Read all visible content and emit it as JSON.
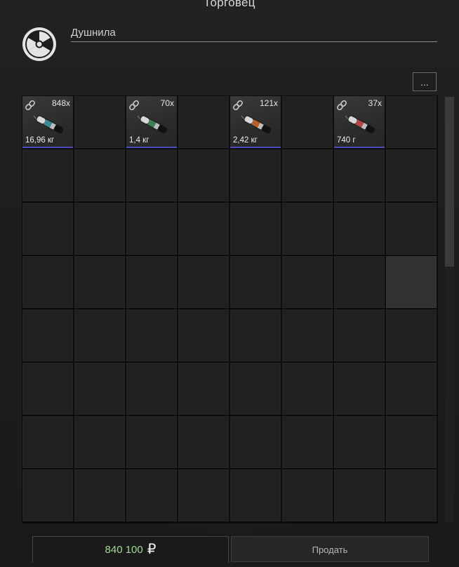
{
  "window": {
    "title": "Торговец"
  },
  "trader": {
    "icon": "radiation-icon",
    "name": "Душнила"
  },
  "toolbar": {
    "more_label": "..."
  },
  "inventory": {
    "columns": 8,
    "rows": 8,
    "items": [
      {
        "quantity": "848x",
        "weight": "16,96 кг",
        "icon": "canister-icon",
        "band_color": "#3d8a95"
      },
      {
        "quantity": "70x",
        "weight": "1,4 кг",
        "icon": "canister-icon",
        "band_color": "#3f7d55"
      },
      {
        "quantity": "121x",
        "weight": "2,42 кг",
        "icon": "canister-icon",
        "band_color": "#b4612c"
      },
      {
        "quantity": "37x",
        "weight": "740 г",
        "icon": "canister-icon",
        "band_color": "#b04848"
      }
    ],
    "item_border_color": "#4d4dbd",
    "highlighted_cell": {
      "row": 4,
      "column": 8
    }
  },
  "footer": {
    "money_amount": "840 100",
    "currency_symbol": "₽",
    "money_color": "#9ed993",
    "sell_label": "Продать"
  }
}
